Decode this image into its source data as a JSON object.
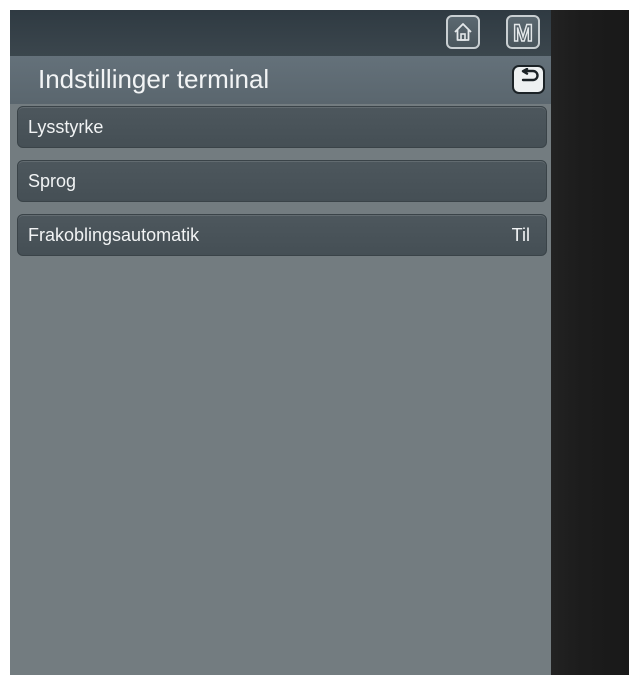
{
  "header": {
    "title": "Indstillinger terminal"
  },
  "top_buttons": {
    "home_icon": "home-icon",
    "menu_icon": "menu-m-icon",
    "menu_letter": "M"
  },
  "back_icon": "back-arrow-icon",
  "settings_list": [
    {
      "label": "Lysstyrke",
      "value": ""
    },
    {
      "label": "Sprog",
      "value": ""
    },
    {
      "label": "Frakoblingsautomatik",
      "value": "Til"
    }
  ],
  "colors": {
    "screen_background": "#737c80",
    "row_background": "#4d575d",
    "text": "#f1f3f4"
  }
}
